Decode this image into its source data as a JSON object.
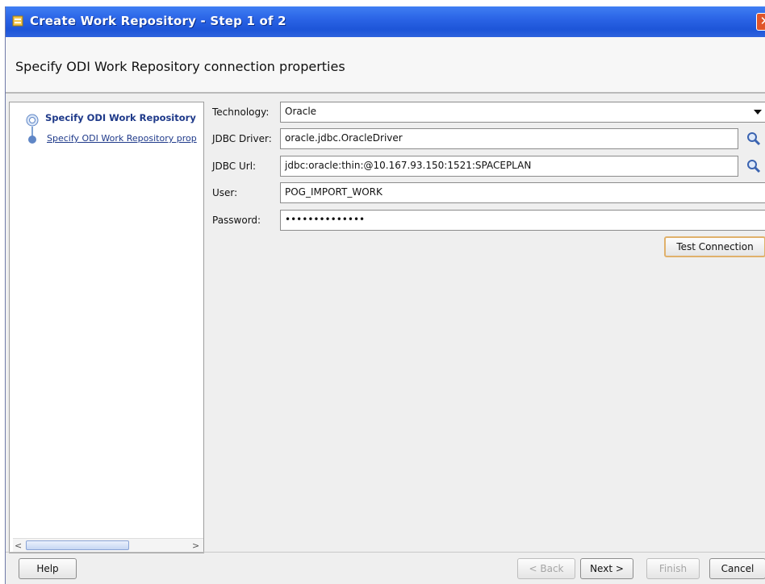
{
  "window": {
    "title": "Create Work Repository - Step 1 of 2",
    "close_glyph": "✕",
    "icons": {
      "app": "odi-app-icon",
      "close": "close-icon"
    }
  },
  "header": {
    "heading": "Specify ODI Work Repository connection properties"
  },
  "nav": {
    "items": [
      {
        "label": "Specify ODI Work Repository",
        "state": "current"
      },
      {
        "label": "Specify ODI Work Repository prop",
        "state": "link"
      }
    ],
    "scroll_left": "<",
    "scroll_right": ">"
  },
  "form": {
    "technology": {
      "label": "Technology:",
      "value": "Oracle"
    },
    "jdbc_driver": {
      "label": "JDBC Driver:",
      "value": "oracle.jdbc.OracleDriver"
    },
    "jdbc_url": {
      "label": "JDBC Url:",
      "value": "jdbc:oracle:thin:@10.167.93.150:1521:SPACEPLAN"
    },
    "user": {
      "label": "User:",
      "value": "POG_IMPORT_WORK"
    },
    "password": {
      "label": "Password:",
      "value": "••••••••••••••"
    },
    "test_connection": "Test Connection"
  },
  "buttons": {
    "help": "Help",
    "back": "< Back",
    "next": "Next >",
    "finish": "Finish",
    "cancel": "Cancel"
  },
  "colors": {
    "titlebar": "#2b64e6",
    "link": "#1f3a8a",
    "focus_border": "#e0b16b"
  }
}
